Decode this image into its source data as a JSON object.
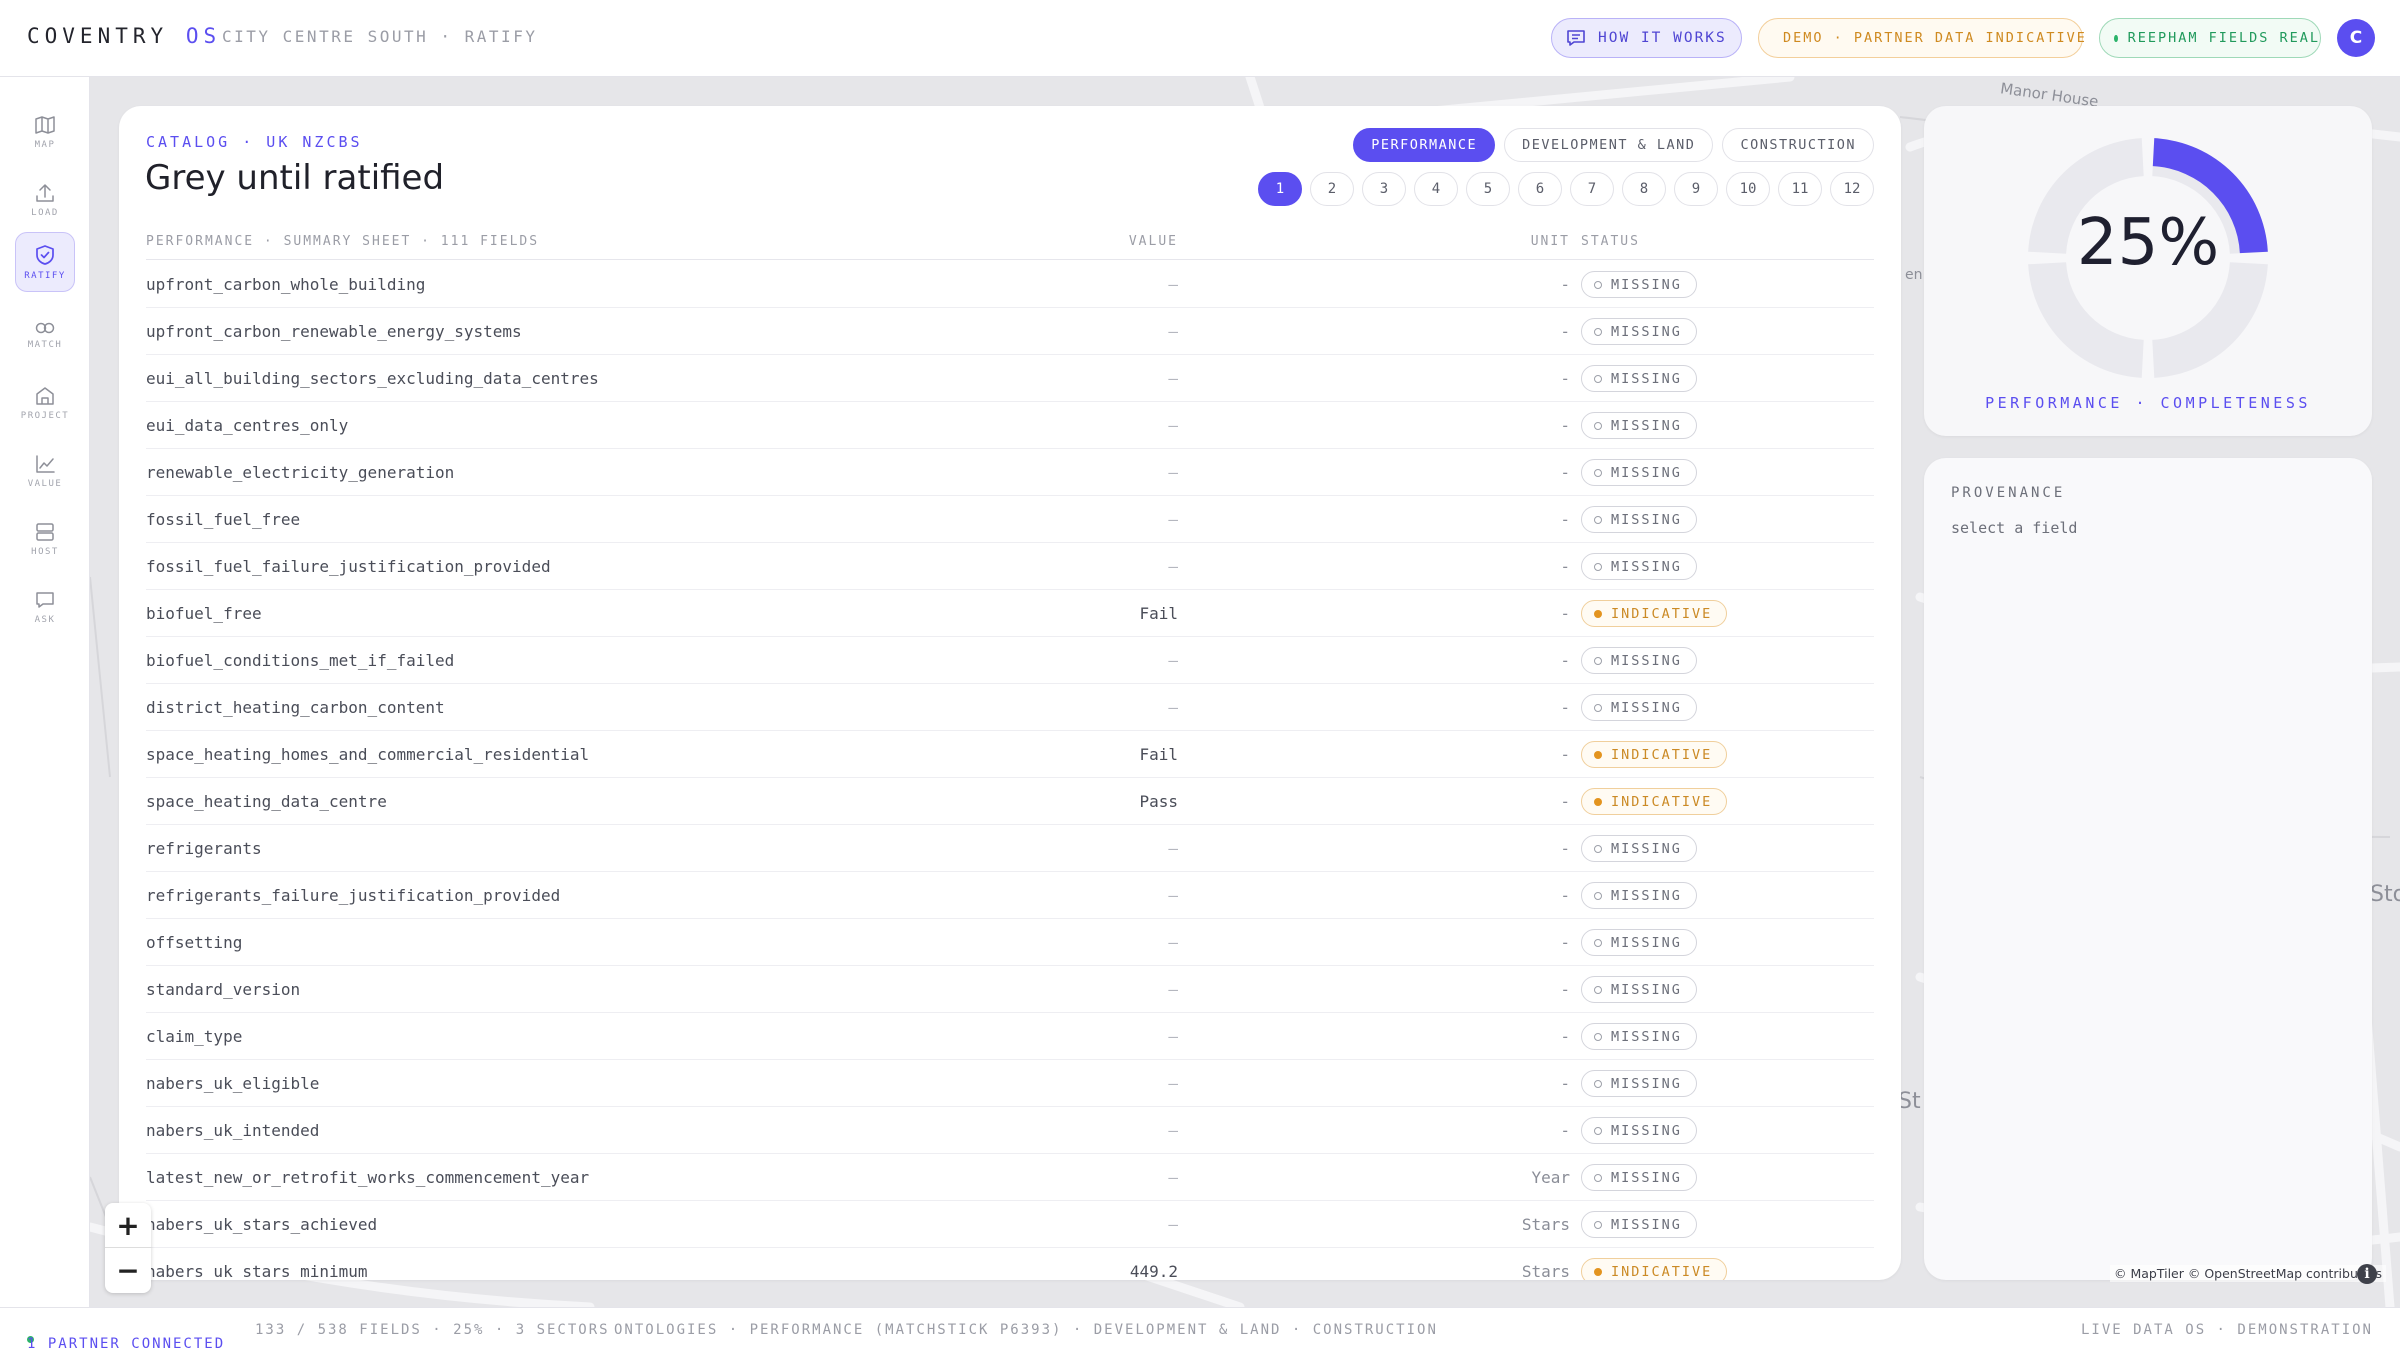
{
  "header": {
    "brand": "COVENTRY",
    "brand_suffix": "OS",
    "breadcrumb": "CITY CENTRE SOUTH · RATIFY",
    "how_it_works": "HOW IT WORKS",
    "demo_badge": "DEMO · PARTNER DATA INDICATIVE",
    "real_badge": "REEPHAM FIELDS REAL",
    "avatar_initial": "C"
  },
  "sidebar": {
    "items": [
      {
        "label": "MAP",
        "icon": "map-icon"
      },
      {
        "label": "LOAD",
        "icon": "upload-icon"
      },
      {
        "label": "RATIFY",
        "icon": "shield-check-icon",
        "active": true
      },
      {
        "label": "MATCH",
        "icon": "link-icon"
      },
      {
        "label": "PROJECT",
        "icon": "building-icon"
      },
      {
        "label": "VALUE",
        "icon": "chart-line-icon"
      },
      {
        "label": "HOST",
        "icon": "server-icon"
      },
      {
        "label": "ASK",
        "icon": "chat-icon"
      }
    ]
  },
  "map": {
    "labels": [
      "Manor House",
      "en",
      "Sto",
      "St"
    ]
  },
  "catalog": {
    "eyebrow": "CATALOG · UK NZCBS",
    "title": "Grey until ratified",
    "tabs": [
      "PERFORMANCE",
      "DEVELOPMENT & LAND",
      "CONSTRUCTION"
    ],
    "active_tab": 0,
    "pages": [
      "1",
      "2",
      "3",
      "4",
      "5",
      "6",
      "7",
      "8",
      "9",
      "10",
      "11",
      "12"
    ],
    "active_page": 0,
    "columns": {
      "field": "PERFORMANCE · SUMMARY SHEET · 111 FIELDS",
      "value": "VALUE",
      "unit": "UNIT",
      "status": "STATUS"
    },
    "rows": [
      {
        "field": "upfront_carbon_whole_building",
        "value": "—",
        "unit": "-",
        "status": "MISSING"
      },
      {
        "field": "upfront_carbon_renewable_energy_systems",
        "value": "—",
        "unit": "-",
        "status": "MISSING"
      },
      {
        "field": "eui_all_building_sectors_excluding_data_centres",
        "value": "—",
        "unit": "-",
        "status": "MISSING"
      },
      {
        "field": "eui_data_centres_only",
        "value": "—",
        "unit": "-",
        "status": "MISSING"
      },
      {
        "field": "renewable_electricity_generation",
        "value": "—",
        "unit": "-",
        "status": "MISSING"
      },
      {
        "field": "fossil_fuel_free",
        "value": "—",
        "unit": "-",
        "status": "MISSING"
      },
      {
        "field": "fossil_fuel_failure_justification_provided",
        "value": "—",
        "unit": "-",
        "status": "MISSING"
      },
      {
        "field": "biofuel_free",
        "value": "Fail",
        "unit": "-",
        "status": "INDICATIVE"
      },
      {
        "field": "biofuel_conditions_met_if_failed",
        "value": "—",
        "unit": "-",
        "status": "MISSING"
      },
      {
        "field": "district_heating_carbon_content",
        "value": "—",
        "unit": "-",
        "status": "MISSING"
      },
      {
        "field": "space_heating_homes_and_commercial_residential",
        "value": "Fail",
        "unit": "-",
        "status": "INDICATIVE"
      },
      {
        "field": "space_heating_data_centre",
        "value": "Pass",
        "unit": "-",
        "status": "INDICATIVE"
      },
      {
        "field": "refrigerants",
        "value": "—",
        "unit": "-",
        "status": "MISSING"
      },
      {
        "field": "refrigerants_failure_justification_provided",
        "value": "—",
        "unit": "-",
        "status": "MISSING"
      },
      {
        "field": "offsetting",
        "value": "—",
        "unit": "-",
        "status": "MISSING"
      },
      {
        "field": "standard_version",
        "value": "—",
        "unit": "-",
        "status": "MISSING"
      },
      {
        "field": "claim_type",
        "value": "—",
        "unit": "-",
        "status": "MISSING"
      },
      {
        "field": "nabers_uk_eligible",
        "value": "—",
        "unit": "-",
        "status": "MISSING"
      },
      {
        "field": "nabers_uk_intended",
        "value": "—",
        "unit": "-",
        "status": "MISSING"
      },
      {
        "field": "latest_new_or_retrofit_works_commencement_year",
        "value": "—",
        "unit": "Year",
        "status": "MISSING"
      },
      {
        "field": "nabers_uk_stars_achieved",
        "value": "—",
        "unit": "Stars",
        "status": "MISSING"
      },
      {
        "field": "nabers_uk_stars_minimum",
        "value": "449.2",
        "unit": "Stars",
        "status": "INDICATIVE"
      }
    ]
  },
  "completeness": {
    "percent_text": "25%",
    "fraction": 0.25,
    "label": "PERFORMANCE · COMPLETENESS",
    "segments": 4
  },
  "provenance": {
    "title": "PROVENANCE",
    "placeholder": "select a field"
  },
  "map_attribution": "© MapTiler © OpenStreetMap contributors",
  "footer": {
    "partner": "1 PARTNER CONNECTED",
    "stats": "133 / 538 FIELDS · 25% · 3 SECTORS",
    "ontologies": "ONTOLOGIES · PERFORMANCE (MATCHSTICK P6393) · DEVELOPMENT & LAND · CONSTRUCTION",
    "right": "LIVE DATA OS · DEMONSTRATION"
  },
  "colors": {
    "accent": "#5b4ef0",
    "missing": "#9da0a9",
    "indicative": "#e3941f",
    "real": "#2bb36a"
  }
}
